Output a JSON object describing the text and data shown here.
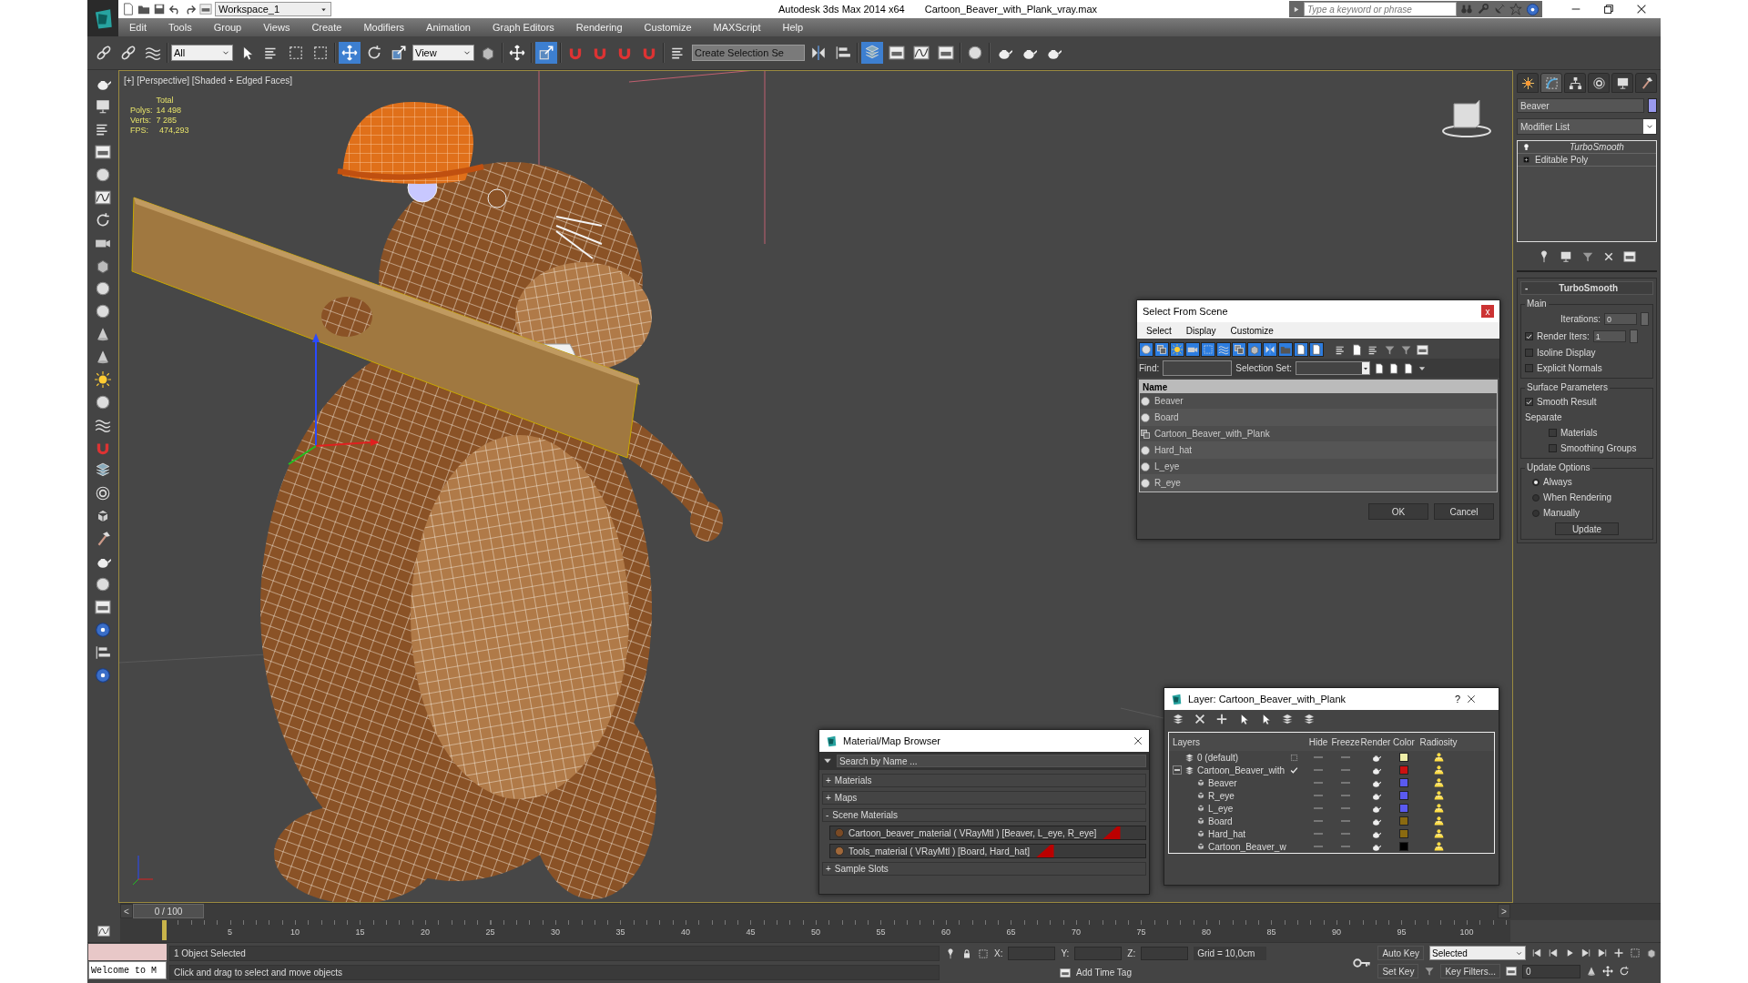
{
  "title_bar": {
    "workspace": "Workspace_1",
    "app_title": "Autodesk 3ds Max  2014 x64",
    "file_name": "Cartoon_Beaver_with_Plank_vray.max",
    "search_placeholder": "Type a keyword or phrase"
  },
  "menu_bar": [
    "Edit",
    "Tools",
    "Group",
    "Views",
    "Create",
    "Modifiers",
    "Animation",
    "Graph Editors",
    "Rendering",
    "Customize",
    "MAXScript",
    "Help"
  ],
  "main_toolbar": [
    {
      "kind": "tool",
      "selected": false
    },
    {
      "kind": "tool",
      "selected": false
    },
    {
      "kind": "tool",
      "selected": false
    },
    {
      "kind": "separator"
    },
    {
      "kind": "dropdown",
      "value": "All"
    },
    {
      "kind": "tool",
      "selected": false
    },
    {
      "kind": "tool",
      "selected": false
    },
    {
      "kind": "tool",
      "selected": false
    },
    {
      "kind": "tool",
      "selected": false
    },
    {
      "kind": "separator"
    },
    {
      "kind": "tool",
      "selected": true
    },
    {
      "kind": "tool",
      "selected": false
    },
    {
      "kind": "tool",
      "selected": false
    },
    {
      "kind": "dropdown",
      "value": "View"
    },
    {
      "kind": "tool",
      "selected": false
    },
    {
      "kind": "separator"
    },
    {
      "kind": "tool",
      "selected": false
    },
    {
      "kind": "separator"
    },
    {
      "kind": "tool",
      "selected": true
    },
    {
      "kind": "separator"
    },
    {
      "kind": "tool",
      "selected": false
    },
    {
      "kind": "tool",
      "selected": false
    },
    {
      "kind": "tool",
      "selected": false
    },
    {
      "kind": "tool",
      "selected": false
    },
    {
      "kind": "separator"
    },
    {
      "kind": "tool",
      "selected": false
    },
    {
      "kind": "field",
      "placeholder": "Create Selection Se"
    },
    {
      "kind": "tool",
      "selected": false
    },
    {
      "kind": "tool",
      "selected": false
    },
    {
      "kind": "separator"
    },
    {
      "kind": "tool",
      "selected": true
    },
    {
      "kind": "tool",
      "selected": false
    },
    {
      "kind": "tool",
      "selected": false
    },
    {
      "kind": "tool",
      "selected": false
    },
    {
      "kind": "separator"
    },
    {
      "kind": "tool",
      "selected": false
    },
    {
      "kind": "separator"
    },
    {
      "kind": "tool",
      "selected": false
    },
    {
      "kind": "tool",
      "selected": false
    },
    {
      "kind": "tool",
      "selected": false
    }
  ],
  "viewport": {
    "label": "[+] [Perspective] [Shaded + Edged Faces]",
    "stats_header": "Total",
    "stats": [
      {
        "label": "Polys:",
        "value": "14 498"
      },
      {
        "label": "Verts:",
        "value": "7 285"
      }
    ],
    "fps": {
      "label": "FPS:",
      "value": "474,293"
    }
  },
  "command_panel": {
    "tabs": [
      {
        "selected": false
      },
      {
        "selected": true
      },
      {
        "selected": false
      },
      {
        "selected": false
      },
      {
        "selected": false
      },
      {
        "selected": false
      }
    ],
    "object_name": "Beaver",
    "modifier_list": "Modifier List",
    "stack": [
      {
        "kind": "modifier",
        "label": "TurboSmooth"
      },
      {
        "kind": "base",
        "label": "Editable Poly"
      }
    ],
    "rollout": {
      "sign": "-",
      "title": "TurboSmooth",
      "groups": [
        {
          "title": "Main",
          "controls": [
            {
              "kind": "spinner",
              "label": "Iterations:",
              "value": "0"
            },
            {
              "kind": "check_spinner",
              "label": "Render Iters:",
              "value": "1",
              "checked": true
            },
            {
              "kind": "checkbox",
              "label": "Isoline Display",
              "checked": false
            },
            {
              "kind": "checkbox",
              "label": "Explicit Normals",
              "checked": false
            }
          ]
        },
        {
          "title": "Surface Parameters",
          "controls": [
            {
              "kind": "checkbox",
              "label": "Smooth Result",
              "checked": true
            },
            {
              "kind": "text",
              "label": "Separate"
            },
            {
              "kind": "subcheckbox",
              "label": "Materials",
              "checked": false
            },
            {
              "kind": "subcheckbox",
              "label": "Smoothing Groups",
              "checked": false
            }
          ]
        },
        {
          "title": "Update Options",
          "controls": [
            {
              "kind": "radio",
              "label": "Always",
              "selected": true
            },
            {
              "kind": "radio",
              "label": "When Rendering",
              "selected": false
            },
            {
              "kind": "radio",
              "label": "Manually",
              "selected": false
            },
            {
              "kind": "button",
              "label": "Update"
            }
          ]
        }
      ]
    }
  },
  "select_from_scene": {
    "title": "Select From Scene",
    "close": "x",
    "menu": [
      "Select",
      "Display",
      "Customize"
    ],
    "filters": [
      {
        "selected": true
      },
      {
        "selected": true
      },
      {
        "selected": true
      },
      {
        "selected": true
      },
      {
        "selected": true
      },
      {
        "selected": true
      },
      {
        "selected": true
      },
      {
        "selected": true
      },
      {
        "selected": true
      },
      {
        "selected": true
      },
      {
        "selected": true
      },
      {
        "selected": true
      }
    ],
    "find_label": "Find:",
    "selection_set_label": "Selection Set:",
    "column": "Name",
    "rows": [
      {
        "kind": "geometry",
        "label": "Beaver"
      },
      {
        "kind": "geometry",
        "label": "Board"
      },
      {
        "kind": "group",
        "label": "Cartoon_Beaver_with_Plank"
      },
      {
        "kind": "geometry",
        "label": "Hard_hat"
      },
      {
        "kind": "geometry",
        "label": "L_eye"
      },
      {
        "kind": "geometry",
        "label": "R_eye"
      }
    ],
    "buttons": [
      "OK",
      "Cancel"
    ]
  },
  "material_browser": {
    "title": "Material/Map Browser",
    "search_placeholder": "Search by Name ...",
    "groups": [
      {
        "sign": "+",
        "label": "Materials"
      },
      {
        "sign": "+",
        "label": "Maps"
      },
      {
        "sign": "-",
        "label": "Scene Materials",
        "items": [
          {
            "label": "Cartoon_beaver_material  ( VRayMtl ) [Beaver, L_eye, R_eye]"
          },
          {
            "label": "Tools_material  ( VRayMtl ) [Board, Hard_hat]"
          }
        ]
      },
      {
        "sign": "+",
        "label": "Sample Slots"
      }
    ]
  },
  "layer_dialog": {
    "title": "Layer: Cartoon_Beaver_with_Plank",
    "help": "?",
    "columns": [
      "Layers",
      "Hide",
      "Freeze",
      "Render",
      "Color",
      "Radiosity"
    ],
    "layers": [
      {
        "label": "0 (default)",
        "current": false,
        "color": "#eeeea8"
      },
      {
        "label": "Cartoon_Beaver_with",
        "current": true,
        "expanded": true,
        "color": "#cc1111",
        "children": [
          {
            "label": "Beaver",
            "color": "#5a5af0"
          },
          {
            "label": "R_eye",
            "color": "#5a5af0"
          },
          {
            "label": "L_eye",
            "color": "#5a5af0"
          },
          {
            "label": "Board",
            "color": "#8a6a10"
          },
          {
            "label": "Hard_hat",
            "color": "#8a6a10"
          },
          {
            "label": "Cartoon_Beaver_w",
            "color": "#000000"
          }
        ]
      }
    ]
  },
  "timeline": {
    "prev": "<",
    "position": "0 / 100",
    "next": ">",
    "ticks": [
      "5",
      "10",
      "15",
      "20",
      "25",
      "30",
      "35",
      "40",
      "45",
      "50",
      "55",
      "60",
      "65",
      "70",
      "75",
      "80",
      "85",
      "90",
      "95",
      "100"
    ]
  },
  "status_bar": {
    "listener": "Welcome to M",
    "selection": "1 Object Selected",
    "prompt": "Click and drag to select and move objects",
    "coords": [
      "X:",
      "Y:",
      "Z:"
    ],
    "grid": "Grid = 10,0cm",
    "add_time_tag": "Add Time Tag",
    "auto_key": "Auto Key",
    "key_mode": "Selected",
    "set_key": "Set Key",
    "key_filters": "Key Filters...",
    "frame": "0"
  }
}
